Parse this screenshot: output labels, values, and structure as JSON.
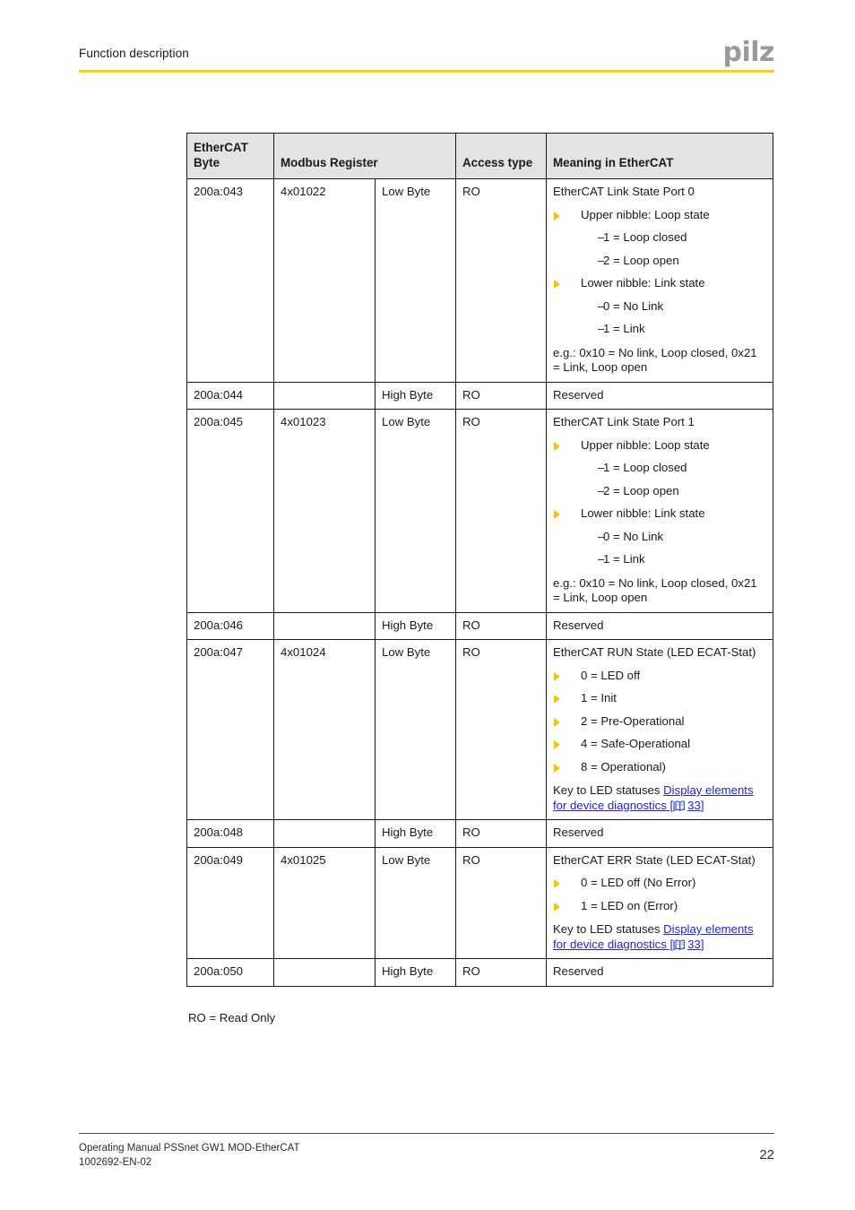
{
  "header": {
    "title": "Function description",
    "logo_text": "pilz",
    "rule_color": "#F5D800",
    "logo_color": "#9A9A9A"
  },
  "table": {
    "columns": [
      {
        "label": "EtherCAT Byte"
      },
      {
        "label": "Modbus Register"
      },
      {
        "label": ""
      },
      {
        "label": "Access type"
      },
      {
        "label": "Meaning in EtherCAT"
      }
    ],
    "rows": [
      {
        "byte": "200a:043",
        "register": "4x01022",
        "byte_part": "Low Byte",
        "access": "RO",
        "meaning_title": "EtherCAT Link State Port 0",
        "groups": [
          {
            "arrow": "Upper nibble: Loop state",
            "dashes": [
              "1 = Loop closed",
              "2 = Loop open"
            ]
          },
          {
            "arrow": "Lower nibble: Link state",
            "dashes": [
              "0 = No Link",
              "1 = Link"
            ]
          }
        ],
        "note": "e.g.: 0x10 = No link, Loop closed, 0x21 = Link, Loop open"
      },
      {
        "byte": "200a:044",
        "register": "",
        "byte_part": "High Byte",
        "access": "RO",
        "meaning_title": "Reserved"
      },
      {
        "byte": "200a:045",
        "register": "4x01023",
        "byte_part": "Low Byte",
        "access": "RO",
        "meaning_title": "EtherCAT Link State Port 1",
        "groups": [
          {
            "arrow": "Upper nibble: Loop state",
            "dashes": [
              "1 = Loop closed",
              "2 = Loop open"
            ]
          },
          {
            "arrow": "Lower nibble: Link state",
            "dashes": [
              "0 = No Link",
              "1 = Link"
            ]
          }
        ],
        "note": "e.g.: 0x10 = No link, Loop closed, 0x21 = Link, Loop open"
      },
      {
        "byte": "200a:046",
        "register": "",
        "byte_part": "High Byte",
        "access": "RO",
        "meaning_title": "Reserved"
      },
      {
        "byte": "200a:047",
        "register": "4x01024",
        "byte_part": "Low Byte",
        "access": "RO",
        "meaning_title": "EtherCAT RUN State (LED ECAT-Stat)",
        "arrows": [
          "0 = LED off",
          "1 = Init",
          "2 = Pre-Operational",
          "4 = Safe-Operational",
          "8 = Operational)"
        ],
        "xref": {
          "lead_text": "Key to LED statuses ",
          "link_text": "Display elements for device diagnostics [",
          "icon": "book-icon",
          "page_ref": "33]",
          "color": "#2222DD"
        }
      },
      {
        "byte": "200a:048",
        "register": "",
        "byte_part": "High Byte",
        "access": "RO",
        "meaning_title": "Reserved"
      },
      {
        "byte": "200a:049",
        "register": "4x01025",
        "byte_part": "Low Byte",
        "access": "RO",
        "meaning_title": "EtherCAT ERR State (LED ECAT-Stat)",
        "arrows": [
          "0 = LED off (No Error)",
          "1 = LED on (Error)"
        ],
        "xref": {
          "lead_text": "Key to LED statuses ",
          "link_text": "Display elements for device diagnostics [",
          "icon": "book-icon",
          "page_ref": "33]",
          "color": "#2222DD"
        }
      },
      {
        "byte": "200a:050",
        "register": "",
        "byte_part": "High Byte",
        "access": "RO",
        "meaning_title": "Reserved"
      }
    ],
    "legend": "RO = Read Only",
    "bullet_color": "#F5C400"
  },
  "footer": {
    "line1": "Operating Manual PSSnet GW1 MOD-EtherCAT",
    "line2": "1002692-EN-02",
    "page_number": "22"
  }
}
